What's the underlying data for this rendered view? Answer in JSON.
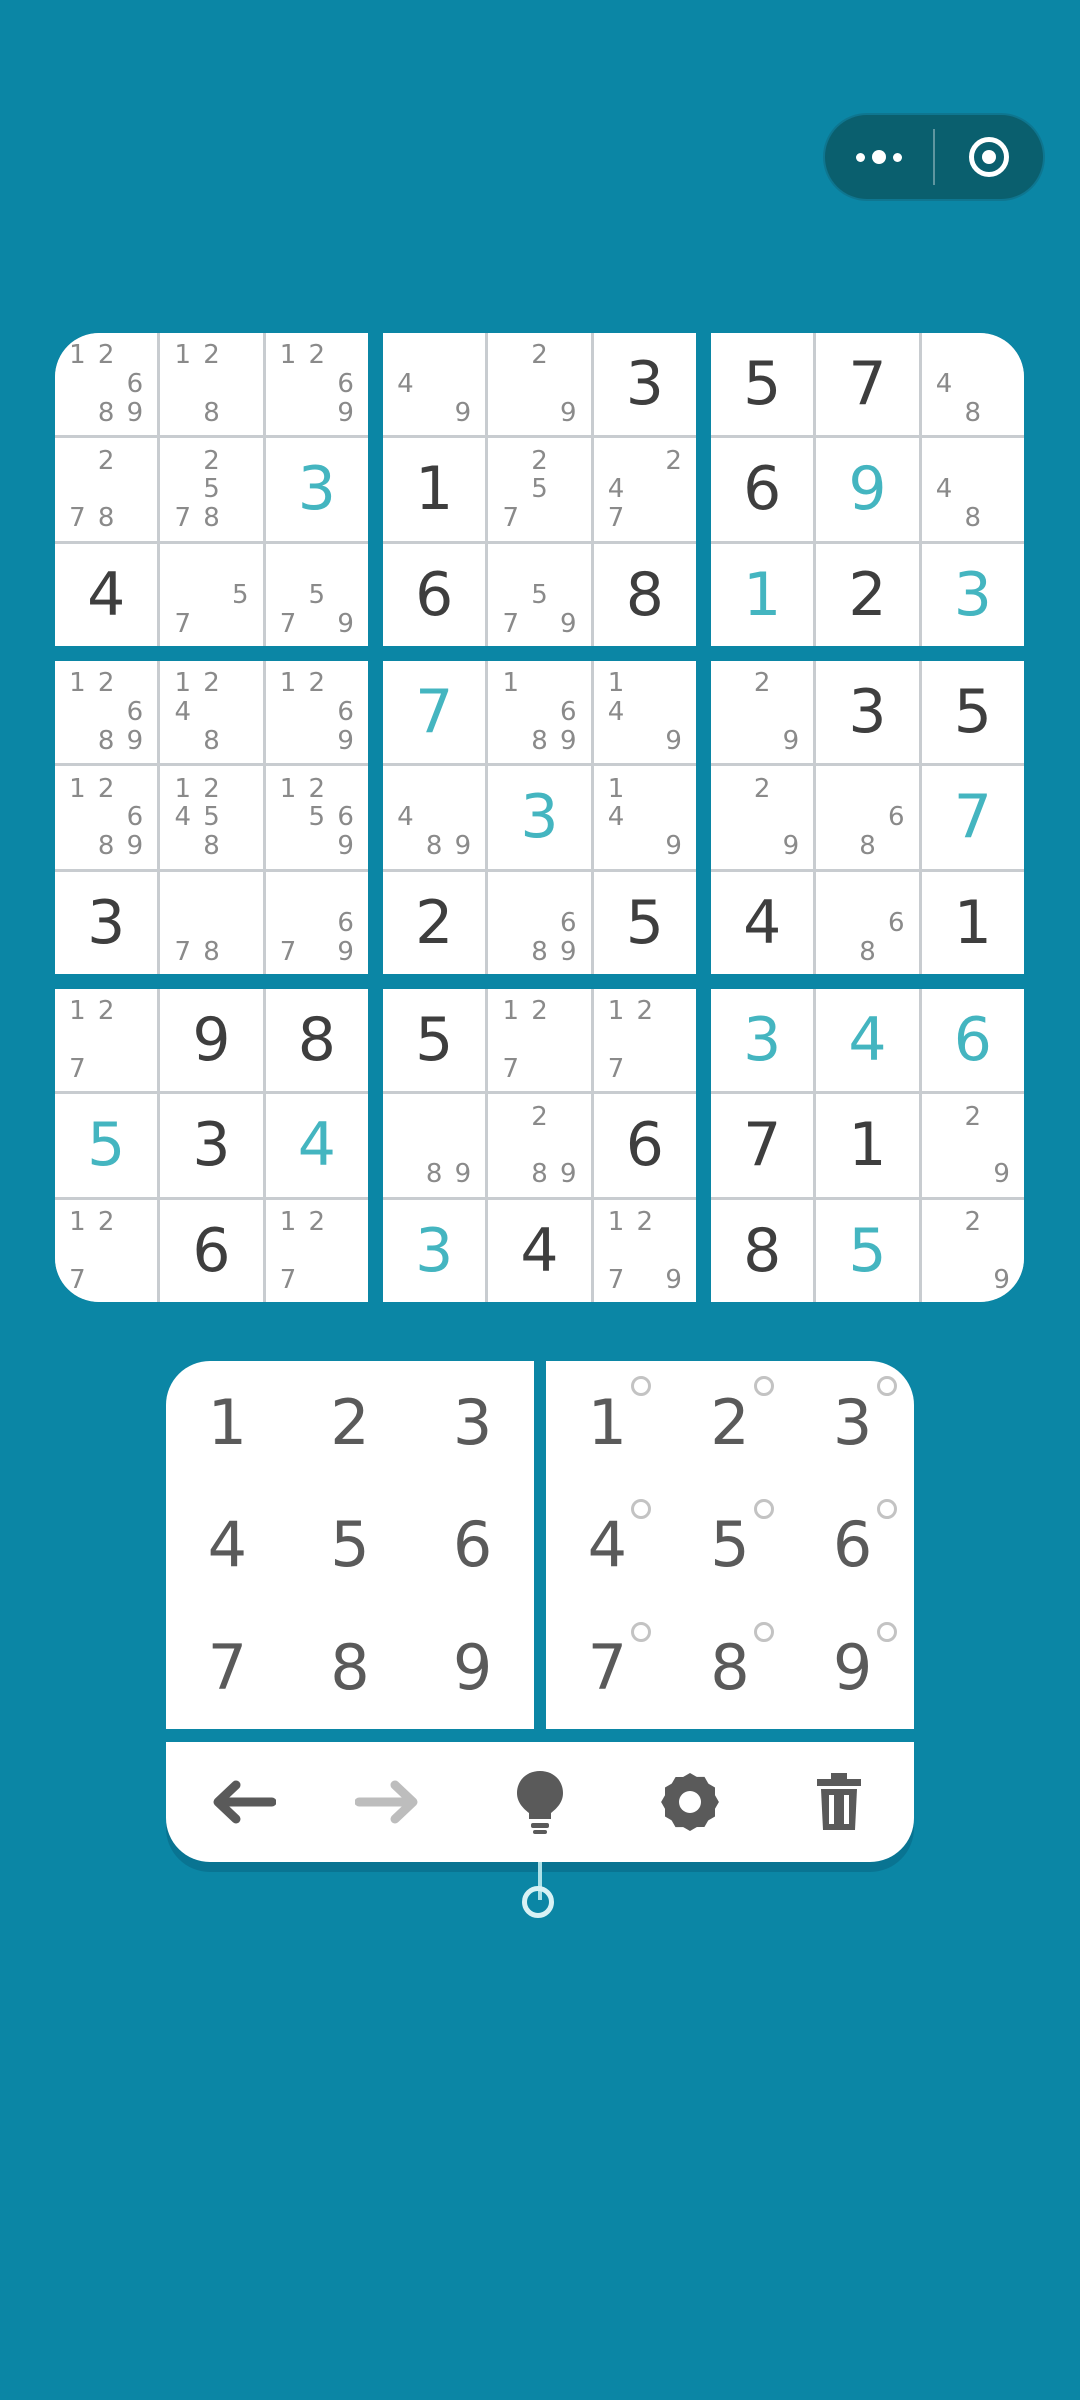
{
  "colors": {
    "background": "#0b86a5",
    "given": "#3e3e3e",
    "user": "#44b5c0",
    "notes": "#8a8a8a",
    "pad": "#5a5a5a"
  },
  "capsule": {
    "menu_icon": "more-dots-icon",
    "close_icon": "target-close-icon"
  },
  "board": {
    "boxes": [
      [
        {
          "notes": [
            "1",
            "2",
            "",
            "",
            "",
            "6",
            "",
            "8",
            "9"
          ]
        },
        {
          "notes": [
            "1",
            "2",
            "",
            "",
            "",
            "",
            "",
            "8",
            ""
          ]
        },
        {
          "notes": [
            "1",
            "2",
            "",
            "",
            "",
            "6",
            "",
            "",
            "9"
          ]
        },
        {
          "notes": [
            "",
            "2",
            "",
            "",
            "",
            "",
            "7",
            "8",
            ""
          ]
        },
        {
          "notes": [
            "",
            "2",
            "",
            "",
            "5",
            "",
            "7",
            "8",
            ""
          ]
        },
        {
          "value": "3",
          "user": true
        },
        {
          "value": "4"
        },
        {
          "notes": [
            "",
            "",
            "",
            "",
            "",
            "5",
            "7",
            "",
            ""
          ]
        },
        {
          "notes": [
            "",
            "",
            "",
            "",
            "5",
            "",
            "7",
            "",
            "9"
          ]
        }
      ],
      [
        {
          "notes": [
            "",
            "",
            "",
            "4",
            "",
            "",
            "",
            "",
            "9"
          ]
        },
        {
          "notes": [
            "",
            "2",
            "",
            "",
            "",
            "",
            "",
            "",
            "9"
          ]
        },
        {
          "value": "3"
        },
        {
          "value": "1"
        },
        {
          "notes": [
            "",
            "2",
            "",
            "",
            "5",
            "",
            "7",
            "",
            ""
          ]
        },
        {
          "notes": [
            "",
            "",
            "2",
            "4",
            "",
            "",
            "7",
            "",
            ""
          ]
        },
        {
          "value": "6"
        },
        {
          "notes": [
            "",
            "",
            "",
            "",
            "5",
            "",
            "7",
            "",
            "9"
          ]
        },
        {
          "value": "8"
        }
      ],
      [
        {
          "value": "5"
        },
        {
          "value": "7"
        },
        {
          "notes": [
            "",
            "",
            "",
            "4",
            "",
            "",
            "",
            "8",
            ""
          ]
        },
        {
          "value": "6"
        },
        {
          "value": "9",
          "user": true
        },
        {
          "notes": [
            "",
            "",
            "",
            "4",
            "",
            "",
            "",
            "8",
            ""
          ]
        },
        {
          "value": "1",
          "user": true
        },
        {
          "value": "2"
        },
        {
          "value": "3",
          "user": true
        }
      ],
      [
        {
          "notes": [
            "1",
            "2",
            "",
            "",
            "",
            "6",
            "",
            "8",
            "9"
          ]
        },
        {
          "notes": [
            "1",
            "2",
            "",
            "4",
            "",
            "",
            "",
            "8",
            ""
          ]
        },
        {
          "notes": [
            "1",
            "2",
            "",
            "",
            "",
            "6",
            "",
            "",
            "9"
          ]
        },
        {
          "notes": [
            "1",
            "2",
            "",
            "",
            "",
            "6",
            "",
            "8",
            "9"
          ]
        },
        {
          "notes": [
            "1",
            "2",
            "",
            "4",
            "5",
            "",
            "",
            "8",
            ""
          ]
        },
        {
          "notes": [
            "1",
            "2",
            "",
            "",
            "5",
            "6",
            "",
            "",
            "9"
          ]
        },
        {
          "value": "3"
        },
        {
          "notes": [
            "",
            "",
            "",
            "",
            "",
            "",
            "7",
            "8",
            ""
          ]
        },
        {
          "notes": [
            "",
            "",
            "",
            "",
            "",
            "6",
            "7",
            "",
            "9"
          ]
        }
      ],
      [
        {
          "value": "7",
          "user": true
        },
        {
          "notes": [
            "1",
            "",
            "",
            "",
            "",
            "6",
            "",
            "8",
            "9"
          ]
        },
        {
          "notes": [
            "1",
            "",
            "",
            "4",
            "",
            "",
            "",
            "",
            "9"
          ]
        },
        {
          "notes": [
            "",
            "",
            "",
            "4",
            "",
            "",
            "",
            "8",
            "9"
          ]
        },
        {
          "value": "3",
          "user": true
        },
        {
          "notes": [
            "1",
            "",
            "",
            "4",
            "",
            "",
            "",
            "",
            "9"
          ]
        },
        {
          "value": "2"
        },
        {
          "notes": [
            "",
            "",
            "",
            "",
            "",
            "6",
            "",
            "8",
            "9"
          ]
        },
        {
          "value": "5"
        }
      ],
      [
        {
          "notes": [
            "",
            "2",
            "",
            "",
            "",
            "",
            "",
            "",
            "9"
          ]
        },
        {
          "value": "3"
        },
        {
          "value": "5"
        },
        {
          "notes": [
            "",
            "2",
            "",
            "",
            "",
            "",
            "",
            "",
            "9"
          ]
        },
        {
          "notes": [
            "",
            "",
            "",
            "",
            "",
            "6",
            "",
            "8",
            ""
          ]
        },
        {
          "value": "7",
          "user": true
        },
        {
          "value": "4"
        },
        {
          "notes": [
            "",
            "",
            "",
            "",
            "",
            "6",
            "",
            "8",
            ""
          ]
        },
        {
          "value": "1"
        }
      ],
      [
        {
          "notes": [
            "1",
            "2",
            "",
            "",
            "",
            "",
            "7",
            "",
            ""
          ]
        },
        {
          "value": "9"
        },
        {
          "value": "8"
        },
        {
          "value": "5",
          "user": true
        },
        {
          "value": "3"
        },
        {
          "value": "4",
          "user": true
        },
        {
          "notes": [
            "1",
            "2",
            "",
            "",
            "",
            "",
            "7",
            "",
            ""
          ]
        },
        {
          "value": "6"
        },
        {
          "notes": [
            "1",
            "2",
            "",
            "",
            "",
            "",
            "7",
            "",
            ""
          ]
        }
      ],
      [
        {
          "value": "5"
        },
        {
          "notes": [
            "1",
            "2",
            "",
            "",
            "",
            "",
            "7",
            "",
            ""
          ]
        },
        {
          "notes": [
            "1",
            "2",
            "",
            "",
            "",
            "",
            "7",
            "",
            ""
          ]
        },
        {
          "notes": [
            "",
            "",
            "",
            "",
            "",
            "",
            "",
            "8",
            "9"
          ]
        },
        {
          "notes": [
            "",
            "2",
            "",
            "",
            "",
            "",
            "",
            "8",
            "9"
          ]
        },
        {
          "value": "6"
        },
        {
          "value": "3",
          "user": true
        },
        {
          "value": "4"
        },
        {
          "notes": [
            "1",
            "2",
            "",
            "",
            "",
            "",
            "7",
            "",
            "9"
          ]
        }
      ],
      [
        {
          "value": "3",
          "user": true
        },
        {
          "value": "4",
          "user": true
        },
        {
          "value": "6",
          "user": true
        },
        {
          "value": "7"
        },
        {
          "value": "1"
        },
        {
          "notes": [
            "",
            "2",
            "",
            "",
            "",
            "",
            "",
            "",
            "9"
          ]
        },
        {
          "value": "8"
        },
        {
          "value": "5",
          "user": true
        },
        {
          "notes": [
            "",
            "2",
            "",
            "",
            "",
            "",
            "",
            "",
            "9"
          ]
        }
      ]
    ]
  },
  "pad": {
    "digits": [
      "1",
      "2",
      "3",
      "4",
      "5",
      "6",
      "7",
      "8",
      "9"
    ],
    "note_digits": [
      "1",
      "2",
      "3",
      "4",
      "5",
      "6",
      "7",
      "8",
      "9"
    ]
  },
  "toolbar": {
    "undo_icon": "arrow-left-icon",
    "redo_icon": "arrow-right-icon",
    "hint_icon": "lightbulb-icon",
    "settings_icon": "gear-icon",
    "erase_icon": "trash-icon"
  }
}
